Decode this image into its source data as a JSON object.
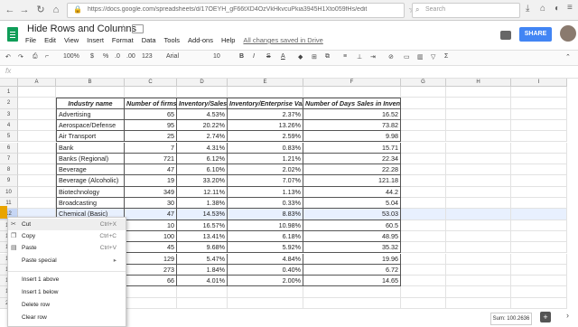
{
  "browser": {
    "back": "←",
    "forward": "→",
    "reload": "↻",
    "home": "⌂",
    "url": "https://docs.google.com/spreadsheets/d/17OEYH_gF66tXD4OzVkHkvcuPkia3945H1Xto059fHs/edit",
    "search_placeholder": "Search"
  },
  "app": {
    "title": "Hide Rows and Columns",
    "menus": [
      "File",
      "Edit",
      "View",
      "Insert",
      "Format",
      "Data",
      "Tools",
      "Add-ons",
      "Help"
    ],
    "saved_status": "All changes saved in Drive",
    "share_label": "SHARE"
  },
  "toolbar": {
    "zoom": "100%",
    "currency": "$",
    "percent": "%",
    "dec_dec": ".0",
    "dec_inc": ".00",
    "more_formats": "123",
    "font": "Arial",
    "font_size": "10",
    "bold": "B",
    "italic": "I",
    "strike": "S",
    "text_color": "A"
  },
  "formula": {
    "fx": "fx"
  },
  "columns": [
    "A",
    "B",
    "C",
    "D",
    "E",
    "F",
    "G",
    "H",
    "I"
  ],
  "rows": [
    "1",
    "2",
    "3",
    "4",
    "5",
    "6",
    "7",
    "8",
    "9",
    "10",
    "11",
    "12",
    "13",
    "14",
    "15",
    "16",
    "17",
    "18",
    "19",
    "20"
  ],
  "table": {
    "headers": [
      "Industry name",
      "Number of firms",
      "Inventory/Sales",
      "Inventory/Enterprise Value",
      "Number of Days Sales in Inventory"
    ],
    "rows": [
      [
        "Advertising",
        "65",
        "4.53%",
        "2.37%",
        "16.52"
      ],
      [
        "Aerospace/Defense",
        "95",
        "20.22%",
        "13.26%",
        "73.82"
      ],
      [
        "Air Transport",
        "25",
        "2.74%",
        "2.59%",
        "9.98"
      ],
      [
        "Bank",
        "7",
        "4.31%",
        "0.83%",
        "15.71"
      ],
      [
        "Banks (Regional)",
        "721",
        "6.12%",
        "1.21%",
        "22.34"
      ],
      [
        "Beverage",
        "47",
        "6.10%",
        "2.02%",
        "22.28"
      ],
      [
        "Beverage (Alcoholic)",
        "19",
        "33.20%",
        "7.07%",
        "121.18"
      ],
      [
        "Biotechnology",
        "349",
        "12.11%",
        "1.13%",
        "44.2"
      ],
      [
        "Broadcasting",
        "30",
        "1.38%",
        "0.33%",
        "5.04"
      ],
      [
        "Chemical (Basic)",
        "47",
        "14.53%",
        "8.83%",
        "53.03"
      ],
      [
        "",
        "10",
        "16.57%",
        "10.98%",
        "60.5"
      ],
      [
        "",
        "100",
        "13.41%",
        "6.18%",
        "48.95"
      ],
      [
        "",
        "45",
        "9.68%",
        "5.92%",
        "35.32"
      ],
      [
        "",
        "129",
        "5.47%",
        "4.84%",
        "19.96"
      ],
      [
        "",
        "273",
        "1.84%",
        "0.40%",
        "6.72"
      ],
      [
        "",
        "66",
        "4.01%",
        "2.00%",
        "14.65"
      ]
    ]
  },
  "context_menu": {
    "items": [
      {
        "label": "Cut",
        "shortcut": "Ctrl+X",
        "icon": "scissors-icon"
      },
      {
        "label": "Copy",
        "shortcut": "Ctrl+C",
        "icon": "copy-icon"
      },
      {
        "label": "Paste",
        "shortcut": "Ctrl+V",
        "icon": "paste-icon"
      },
      {
        "label": "Paste special",
        "shortcut": "▸",
        "icon": ""
      },
      {
        "label": "Insert 1 above",
        "shortcut": "",
        "icon": ""
      },
      {
        "label": "Insert 1 below",
        "shortcut": "",
        "icon": ""
      },
      {
        "label": "Delete row",
        "shortcut": "",
        "icon": ""
      },
      {
        "label": "Clear row",
        "shortcut": "",
        "icon": ""
      }
    ]
  },
  "status": {
    "sum": "Sum: 100.2636",
    "explore": "+",
    "side_arrow": "›"
  },
  "colors": {
    "accent": "#4285f4",
    "sheets_green": "#0f9d58",
    "selection": "#e8f0fe"
  }
}
